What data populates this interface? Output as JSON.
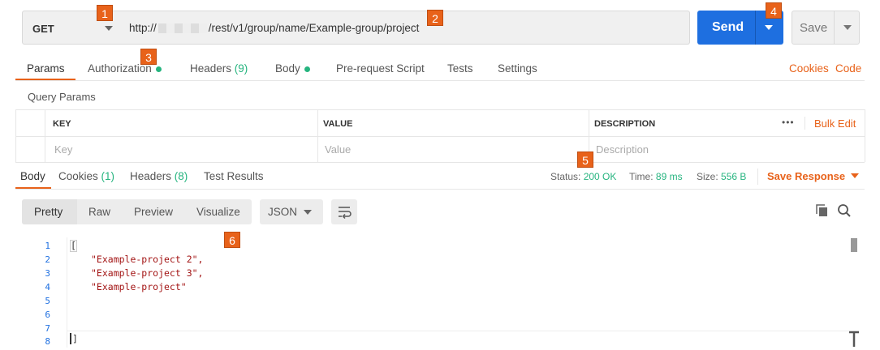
{
  "request": {
    "method": "GET",
    "url_prefix": "http://",
    "url_suffix": "/rest/v1/group/name/Example-group/project",
    "send_label": "Send",
    "save_label": "Save"
  },
  "request_tabs": [
    {
      "label": "Params"
    },
    {
      "label": "Authorization"
    },
    {
      "label": "Headers",
      "count": "(9)"
    },
    {
      "label": "Body"
    },
    {
      "label": "Pre-request Script"
    },
    {
      "label": "Tests"
    },
    {
      "label": "Settings"
    }
  ],
  "request_links": {
    "cookies": "Cookies",
    "code": "Code"
  },
  "query_params": {
    "title": "Query Params",
    "columns": [
      "KEY",
      "VALUE",
      "DESCRIPTION"
    ],
    "more": "•••",
    "bulk_edit": "Bulk Edit",
    "placeholders": {
      "key": "Key",
      "value": "Value",
      "description": "Description"
    }
  },
  "response_tabs": [
    {
      "label": "Body"
    },
    {
      "label": "Cookies",
      "count": "(1)"
    },
    {
      "label": "Headers",
      "count": "(8)"
    },
    {
      "label": "Test Results"
    }
  ],
  "response_meta": {
    "status_label": "Status:",
    "status_value": "200 OK",
    "time_label": "Time:",
    "time_value": "89 ms",
    "size_label": "Size:",
    "size_value": "556 B",
    "save_response": "Save Response"
  },
  "view_modes": [
    "Pretty",
    "Raw",
    "Preview",
    "Visualize"
  ],
  "format": "JSON",
  "code_lines": [
    {
      "n": "1",
      "text": "["
    },
    {
      "n": "2",
      "text": "\"Example-project 2\","
    },
    {
      "n": "3",
      "text": "\"Example-project 3\","
    },
    {
      "n": "4",
      "text": "\"Example-project\""
    },
    {
      "n": "5",
      "text": ""
    },
    {
      "n": "6",
      "text": ""
    },
    {
      "n": "7",
      "text": ""
    },
    {
      "n": "8",
      "text": "]"
    }
  ],
  "badges": [
    "1",
    "2",
    "3",
    "4",
    "5",
    "6"
  ],
  "colors": {
    "accent": "#e8621a",
    "primary": "#1e6fe0",
    "success": "#26b47f"
  }
}
